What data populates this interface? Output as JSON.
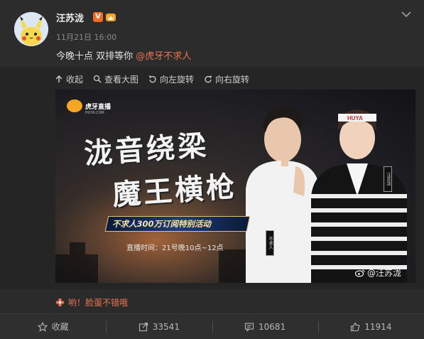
{
  "post": {
    "username": "汪苏泷",
    "verified_badge": "V",
    "time": "11月21日 16:00",
    "text": "今晚十点 双排等你 ",
    "mention": "@虎牙不求人"
  },
  "image_toolbar": {
    "collapse": "收起",
    "view_large": "查看大图",
    "rotate_left": "向左旋转",
    "rotate_right": "向右旋转"
  },
  "poster": {
    "logo_text": "虎牙直播",
    "logo_sub": "HUYA.COM",
    "title_line1": "泷音绕梁",
    "title_line2": "魔王横枪",
    "banner": "不求人300万订阅特别活动",
    "airtime": "直播时间：21号晚10点~12点",
    "watermark": "@汪苏泷",
    "tag_left": "不求人",
    "tag_right": "汪苏泷",
    "shirt_text": "HUYA"
  },
  "repost": {
    "text": "哟！脸蛋不错哦"
  },
  "footer": {
    "favorite": "收藏",
    "repost_count": "33541",
    "comment_count": "10681",
    "like_count": "11914"
  },
  "colors": {
    "accent": "#eb7350",
    "background": "#2b2b2b",
    "text": "#d6d6d6"
  }
}
